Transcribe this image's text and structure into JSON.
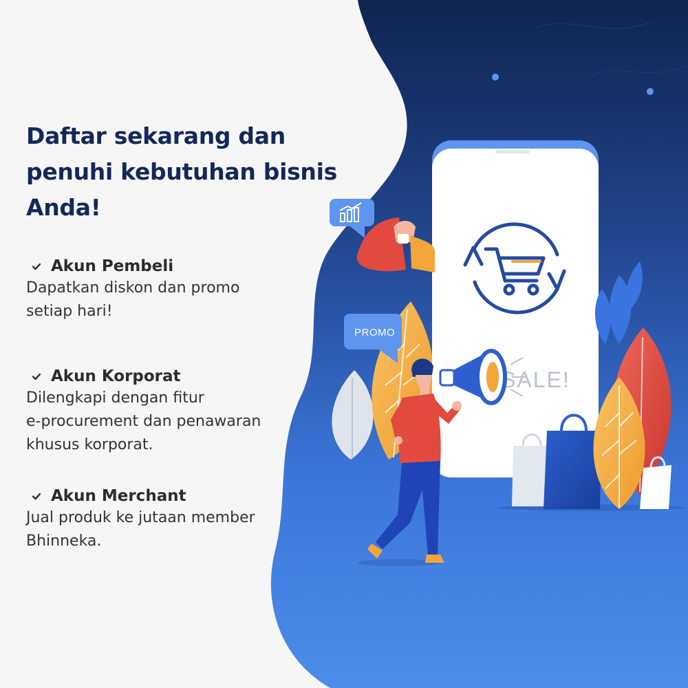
{
  "headline": "Daftar sekarang dan penuhi kebutuhan bisnis Anda!",
  "benefits": [
    {
      "icon": "check-icon",
      "title": "Akun Pembeli",
      "description": "Dapatkan diskon dan promo\nsetiap hari!"
    },
    {
      "icon": "check-icon",
      "title": "Akun Korporat",
      "description": "Dilengkapi dengan fitur\ne-procurement dan penawaran\nkhusus korporat."
    },
    {
      "icon": "check-icon",
      "title": "Akun Merchant",
      "description": "Jual produk ke jutaan member\nBhinneka."
    }
  ],
  "illustration": {
    "promo_bubble": "PROMO",
    "sale_text": "SALE!",
    "chart_bubble_icon": "bar-chart-icon",
    "phone_icon": "shopping-cart-refresh-icon",
    "megaphone_icon": "megaphone-icon"
  },
  "colors": {
    "navy": "#13285a",
    "blue": "#3e7be0",
    "light_blue": "#5b95e8",
    "orange": "#f3a53a",
    "red": "#e2493f",
    "background": "#f6f6f6"
  }
}
